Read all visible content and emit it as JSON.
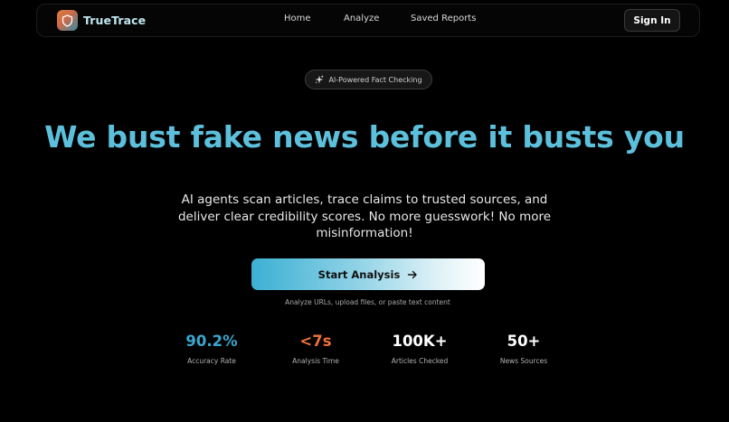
{
  "header": {
    "brand": "TrueTrace",
    "nav": [
      "Home",
      "Analyze",
      "Saved Reports"
    ],
    "signin_label": "Sign In"
  },
  "hero": {
    "badge": "AI-Powered Fact Checking",
    "headline": "We bust fake news before it busts you",
    "subtitle": "AI agents scan articles, trace claims to trusted sources, and deliver clear credibility scores. No more guesswork! No more misinformation!",
    "cta_label": "Start Analysis",
    "cta_hint": "Analyze URLs, upload files, or paste text content"
  },
  "stats": [
    {
      "value": "90.2%",
      "label": "Accuracy Rate",
      "color": "#3aa6cf"
    },
    {
      "value": "<7s",
      "label": "Analysis Time",
      "color": "#f0703c"
    },
    {
      "value": "100K+",
      "label": "Articles Checked",
      "color": "#ffffff"
    },
    {
      "value": "50+",
      "label": "News Sources",
      "color": "#ffffff"
    }
  ],
  "icons": {
    "logo": "shield-icon",
    "badge": "sparkle-icon",
    "cta": "arrow-right-icon"
  },
  "colors": {
    "accent": "#5cc0dc",
    "background": "#000000"
  }
}
